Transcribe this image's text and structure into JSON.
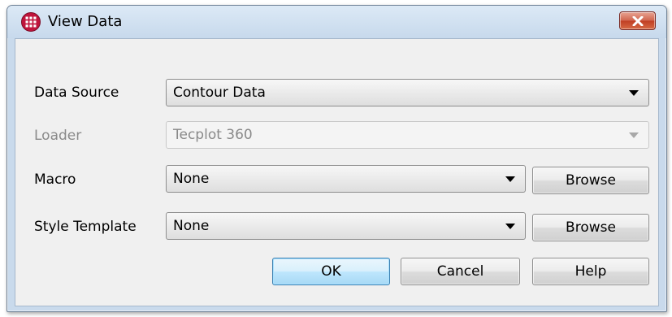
{
  "window": {
    "title": "View Data",
    "app_icon": "tecplot-grid-icon",
    "close_icon": "close-icon",
    "accent_color": "#c9daec",
    "close_color": "#c8452f"
  },
  "form": {
    "data_source": {
      "label": "Data Source",
      "value": "Contour Data"
    },
    "loader": {
      "label": "Loader",
      "value": "Tecplot 360",
      "disabled": true
    },
    "macro": {
      "label": "Macro",
      "value": "None",
      "browse_label": "Browse"
    },
    "style_template": {
      "label": "Style Template",
      "value": "None",
      "browse_label": "Browse"
    }
  },
  "buttons": {
    "ok": "OK",
    "cancel": "Cancel",
    "help": "Help"
  }
}
